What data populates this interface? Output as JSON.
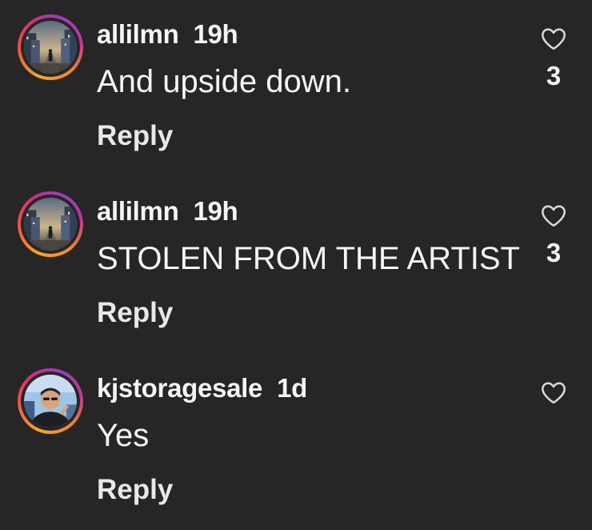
{
  "comments": [
    {
      "username": "allilmn",
      "time": "19h",
      "text": "And upside down.",
      "reply_label": "Reply",
      "like_count": "3",
      "avatar_icon": "city-street-avatar"
    },
    {
      "username": "allilmn",
      "time": "19h",
      "text": "STOLEN FROM THE ARTIST",
      "reply_label": "Reply",
      "like_count": "3",
      "avatar_icon": "city-street-avatar"
    },
    {
      "username": "kjstoragesale",
      "time": "1d",
      "text": "Yes",
      "reply_label": "Reply",
      "like_count": "",
      "avatar_icon": "person-selfie-avatar"
    }
  ],
  "colors": {
    "background": "#262626",
    "text": "#f5f5f5",
    "story_ring": [
      "#f7a42b",
      "#f15a3a",
      "#d62d7a",
      "#9b3cc0"
    ]
  },
  "icons": {
    "like": "heart-outline-icon"
  }
}
